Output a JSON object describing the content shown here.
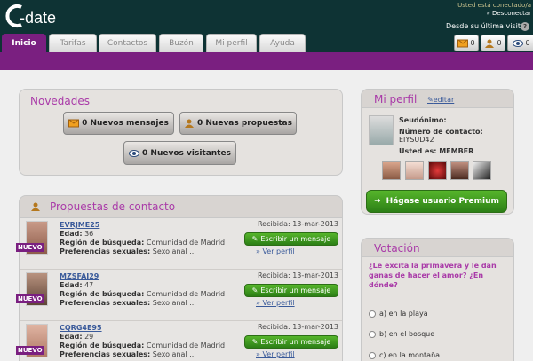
{
  "header": {
    "logo": "C-date",
    "connected": "Usted está conectado/a",
    "logout": "» Desconectar",
    "since_last_visit": "Desde su última visita",
    "help": "?",
    "counters": [
      "0",
      "0",
      "0"
    ]
  },
  "tabs": [
    "Inicio",
    "Tarifas",
    "Contactos",
    "Buzón",
    "Mi perfil",
    "Ayuda"
  ],
  "novedades": {
    "title": "Novedades",
    "buttons": [
      "0 Nuevos mensajes",
      "0 Nuevas propuestas",
      "0 Nuevos visitantes"
    ]
  },
  "propuestas": {
    "title": "Propuestas de contacto",
    "labels": {
      "age": "Edad:",
      "region": "Región de búsqueda:",
      "prefs": "Preferencias sexuales:",
      "new": "NUEVO",
      "write": "Escribir un mensaje",
      "view": "» Ver perfil"
    },
    "items": [
      {
        "nick": "EVRJME25",
        "age": "36",
        "region": "Comunidad de Madrid",
        "prefs": "Sexo anal ...",
        "received": "Recibida: 13-mar-2013"
      },
      {
        "nick": "MZSFAI29",
        "age": "47",
        "region": "Comunidad de Madrid",
        "prefs": "Sexo anal ...",
        "received": "Recibida: 13-mar-2013"
      },
      {
        "nick": "CQRG4E95",
        "age": "29",
        "region": "Comunidad de Madrid",
        "prefs": "Sexo anal ...",
        "received": "Recibida: 13-mar-2013"
      }
    ]
  },
  "perfil": {
    "title": "Mi perfil",
    "edit": "editar",
    "nick_label": "Seudónimo:",
    "contact_label": "Número de contacto:",
    "contact_value": "EIYSUD42",
    "user_type": "Usted es: MEMBER",
    "premium": "Hágase usuario Premium"
  },
  "votacion": {
    "title": "Votación",
    "question": "¿Le excita la primavera y le dan ganas de hacer el amor? ¿En dónde?",
    "options": [
      "a) en la playa",
      "b) en el bosque",
      "c) en la montaña"
    ]
  },
  "colors": {
    "header": "#0e3334",
    "purple": "#7a1f80",
    "title": "#a93aa8",
    "green": "#3b9a1f"
  }
}
